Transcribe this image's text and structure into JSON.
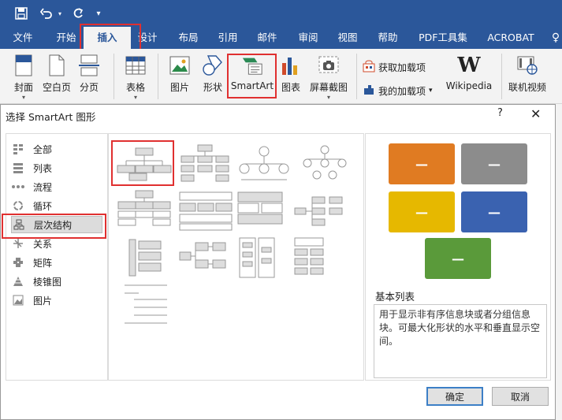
{
  "qat": {
    "save_icon": "save-icon",
    "undo_icon": "undo-icon",
    "redo_icon": "redo-icon",
    "customize_icon": "customize-qat-icon"
  },
  "tabs": [
    {
      "label": "文件"
    },
    {
      "label": "开始"
    },
    {
      "label": "插入"
    },
    {
      "label": "设计"
    },
    {
      "label": "布局"
    },
    {
      "label": "引用"
    },
    {
      "label": "邮件"
    },
    {
      "label": "审阅"
    },
    {
      "label": "视图"
    },
    {
      "label": "帮助"
    },
    {
      "label": "PDF工具集"
    },
    {
      "label": "ACROBAT"
    }
  ],
  "active_tab": "插入",
  "ribbon": {
    "cover": "封面",
    "blank": "空白页",
    "break": "分页",
    "table": "表格",
    "picture": "图片",
    "shapes": "形状",
    "smartart": "SmartArt",
    "chart": "图表",
    "screenshot": "屏幕截图",
    "get_addins": "获取加载项",
    "my_addins": "我的加载项",
    "wikipedia": "Wikipedia",
    "online_video": "联机视频"
  },
  "dialog": {
    "title": "选择 SmartArt 图形",
    "help": "?",
    "categories": [
      {
        "label": "全部"
      },
      {
        "label": "列表"
      },
      {
        "label": "流程"
      },
      {
        "label": "循环"
      },
      {
        "label": "层次结构"
      },
      {
        "label": "关系"
      },
      {
        "label": "矩阵"
      },
      {
        "label": "棱锥图"
      },
      {
        "label": "图片"
      }
    ],
    "selected_category": "层次结构",
    "preview_title": "基本列表",
    "preview_desc": "用于显示非有序信息块或者分组信息块。可最大化形状的水平和垂直显示空间。",
    "ok": "确定",
    "cancel": "取消"
  },
  "colors": {
    "accent": "#2b579a",
    "highlight": "#e03030",
    "orange": "#e07b22",
    "gray": "#8c8c8c",
    "gold": "#e6b800",
    "blue": "#3a62b0",
    "green": "#5a9a3a"
  }
}
